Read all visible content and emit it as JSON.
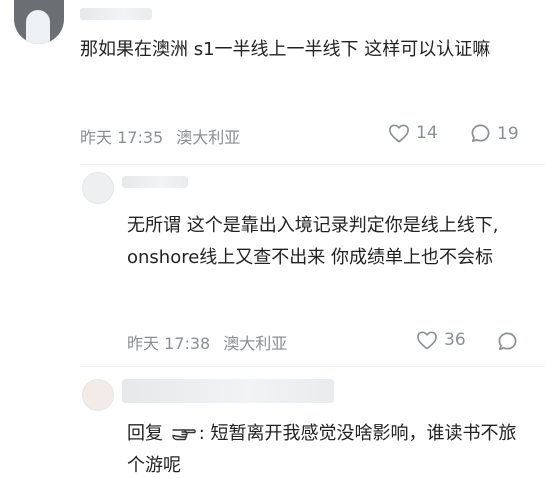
{
  "comments": [
    {
      "text": "那如果在澳洲 s1一半线上一半线下 这样可以认证嘛",
      "time": "昨天 17:35",
      "location": "澳大利亚",
      "likes": "14",
      "replies": "19",
      "icons": {
        "like": "heart-icon",
        "reply": "speech-bubble-icon"
      }
    },
    {
      "text": "无所谓 这个是靠出入境记录判定你是线上线下, onshore线上又查不出来 你成绩单上也不会标",
      "time": "昨天 17:38",
      "location": "澳大利亚",
      "likes": "36",
      "icons": {
        "like": "heart-icon",
        "reply": "speech-bubble-icon"
      }
    },
    {
      "reply_prefix": "回复",
      "reply_target": ":",
      "text": "短暂离开我感觉没啥影响，谁读书不旅个游呢",
      "icons": {
        "target": "pointing-hand-icon"
      }
    }
  ],
  "colors": {
    "text": "#222222",
    "meta": "#8a8f96",
    "background": "#ffffff"
  }
}
